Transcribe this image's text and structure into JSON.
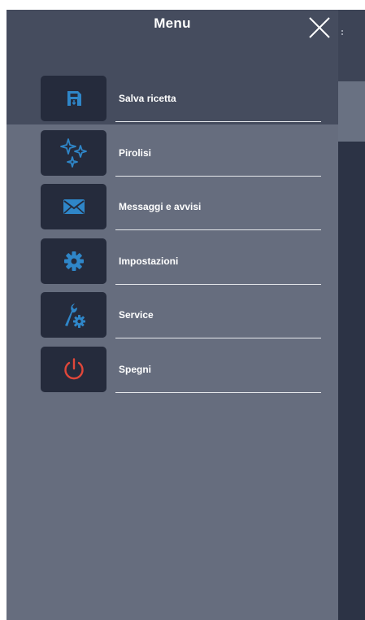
{
  "header": {
    "title": "Menu"
  },
  "menu": {
    "items": [
      {
        "label": "Salva ricetta",
        "icon": "save-icon",
        "color": "#2f86c8"
      },
      {
        "label": "Pirolisi",
        "icon": "sparkles-icon",
        "color": "#2f86c8"
      },
      {
        "label": "Messaggi e avvisi",
        "icon": "envelope-icon",
        "color": "#2f86c8"
      },
      {
        "label": "Impostazioni",
        "icon": "gear-icon",
        "color": "#2f86c8"
      },
      {
        "label": "Service",
        "icon": "wrench-gear-icon",
        "color": "#2f86c8"
      },
      {
        "label": "Spegni",
        "icon": "power-icon",
        "color": "#e0473a"
      }
    ]
  },
  "colors": {
    "drawer_background": "#666d7e",
    "drawer_header": "#454c5e",
    "icon_tile": "#252b3c",
    "accent": "#2f86c8",
    "power": "#e0473a"
  }
}
